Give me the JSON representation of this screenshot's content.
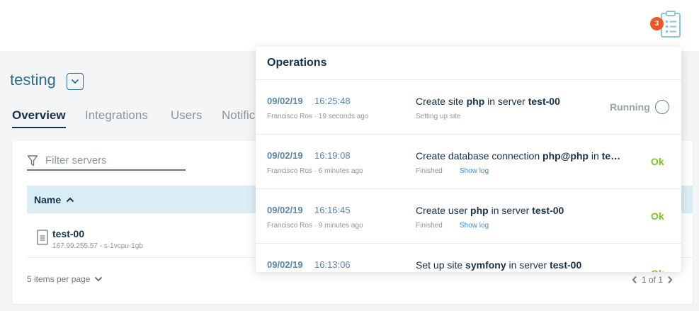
{
  "header": {
    "operations_badge": "3"
  },
  "project": {
    "title": "testing"
  },
  "tabs": [
    {
      "label": "Overview",
      "active": true
    },
    {
      "label": "Integrations",
      "active": false
    },
    {
      "label": "Users",
      "active": false
    },
    {
      "label": "Notific",
      "active": false
    }
  ],
  "servers": {
    "filter_placeholder": "Filter servers",
    "column_name": "Name",
    "rows": [
      {
        "name": "test-00",
        "meta": "167.99.255.57 - s-1vcpu-1gb"
      }
    ],
    "per_page_label": "5 items per page",
    "page_label": "1 of 1"
  },
  "operations": {
    "title": "Operations",
    "items": [
      {
        "date": "09/02/19",
        "time": "16:25:48",
        "user_line": "Francisco Ros · 19 seconds ago",
        "desc_parts": [
          [
            "Create site ",
            false
          ],
          [
            "php",
            true
          ],
          [
            " in server ",
            false
          ],
          [
            "test-00",
            true
          ]
        ],
        "sub": "Setting up site",
        "log": "",
        "status": "Running"
      },
      {
        "date": "09/02/19",
        "time": "16:19:08",
        "user_line": "Francisco Ros · 6 minutes ago",
        "desc_parts": [
          [
            "Create database connection ",
            false
          ],
          [
            "php@php",
            true
          ],
          [
            " in ",
            false
          ],
          [
            "te…",
            true
          ]
        ],
        "sub": "Finished",
        "log": "Show log",
        "status": "Ok"
      },
      {
        "date": "09/02/19",
        "time": "16:16:45",
        "user_line": "Francisco Ros · 9 minutes ago",
        "desc_parts": [
          [
            "Create user ",
            false
          ],
          [
            "php",
            true
          ],
          [
            " in server ",
            false
          ],
          [
            "test-00",
            true
          ]
        ],
        "sub": "Finished",
        "log": "Show log",
        "status": "Ok"
      },
      {
        "date": "09/02/19",
        "time": "16:13:06",
        "user_line": "",
        "desc_parts": [
          [
            "Set up site ",
            false
          ],
          [
            "symfony",
            true
          ],
          [
            " in server ",
            false
          ],
          [
            "test-00",
            true
          ]
        ],
        "sub": "",
        "log": "",
        "status": "Ok"
      }
    ]
  },
  "colors": {
    "accent": "#2c6a8f",
    "badge": "#f0552a",
    "ok": "#7cc02a",
    "table_header": "#d9eef4"
  }
}
